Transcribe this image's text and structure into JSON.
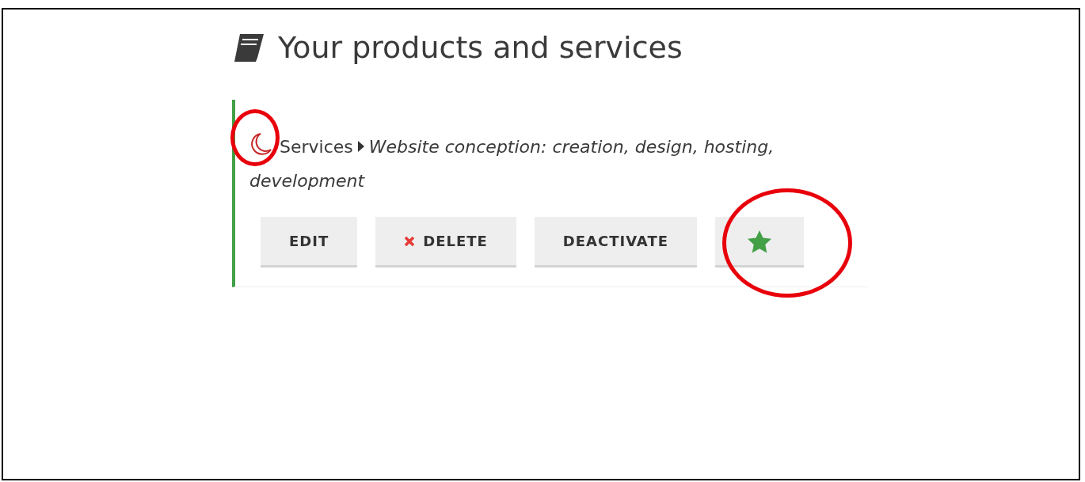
{
  "heading": {
    "title": "Your products and services"
  },
  "item": {
    "category": "Services",
    "name": "Website conception: creation, design, hosting, development"
  },
  "buttons": [
    {
      "kind": "text",
      "label": "EDIT"
    },
    {
      "kind": "delete",
      "label": "DELETE"
    },
    {
      "kind": "text",
      "label": "DEACTIVATE"
    },
    {
      "kind": "star"
    }
  ]
}
